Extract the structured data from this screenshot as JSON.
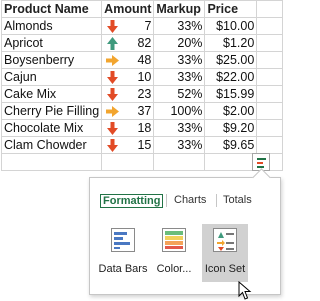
{
  "table": {
    "headers": [
      "Product Name",
      "Amount",
      "Markup",
      "Price"
    ],
    "rows": [
      {
        "name": "Almonds",
        "amount": "7",
        "markup": "33%",
        "price": "$10.00",
        "icon": "arrow-down-icon",
        "color": "#e24b26"
      },
      {
        "name": "Apricot",
        "amount": "82",
        "markup": "20%",
        "price": "$1.20",
        "icon": "arrow-up-icon",
        "color": "#3f9a7d"
      },
      {
        "name": "Boysenberry",
        "amount": "48",
        "markup": "33%",
        "price": "$25.00",
        "icon": "arrow-right-icon",
        "color": "#f2a52f"
      },
      {
        "name": "Cajun",
        "amount": "10",
        "markup": "33%",
        "price": "$22.00",
        "icon": "arrow-down-icon",
        "color": "#e24b26"
      },
      {
        "name": "Cake Mix",
        "amount": "23",
        "markup": "52%",
        "price": "$15.99",
        "icon": "arrow-down-icon",
        "color": "#e24b26"
      },
      {
        "name": "Cherry Pie Filling",
        "amount": "37",
        "markup": "100%",
        "price": "$2.00",
        "icon": "arrow-right-icon",
        "color": "#f2a52f"
      },
      {
        "name": "Chocolate  Mix",
        "amount": "18",
        "markup": "33%",
        "price": "$9.20",
        "icon": "arrow-down-icon",
        "color": "#e24b26"
      },
      {
        "name": "Clam Chowder",
        "amount": "15",
        "markup": "33%",
        "price": "$9.65",
        "icon": "arrow-down-icon",
        "color": "#e24b26"
      }
    ]
  },
  "quick_analysis": {
    "tabs": [
      {
        "label": "Formatting",
        "active": true
      },
      {
        "label": "Charts",
        "active": false
      },
      {
        "label": "Totals",
        "active": false
      }
    ],
    "options": [
      {
        "label": "Data Bars",
        "icon": "data-bars-icon",
        "selected": false
      },
      {
        "label": "Color...",
        "icon": "color-scale-icon",
        "selected": false
      },
      {
        "label": "Icon Set",
        "icon": "icon-set-icon",
        "selected": true
      }
    ]
  },
  "colors": {
    "accent": "#217346",
    "down": "#e24b26",
    "up": "#3f9a7d",
    "side": "#f2a52f"
  }
}
